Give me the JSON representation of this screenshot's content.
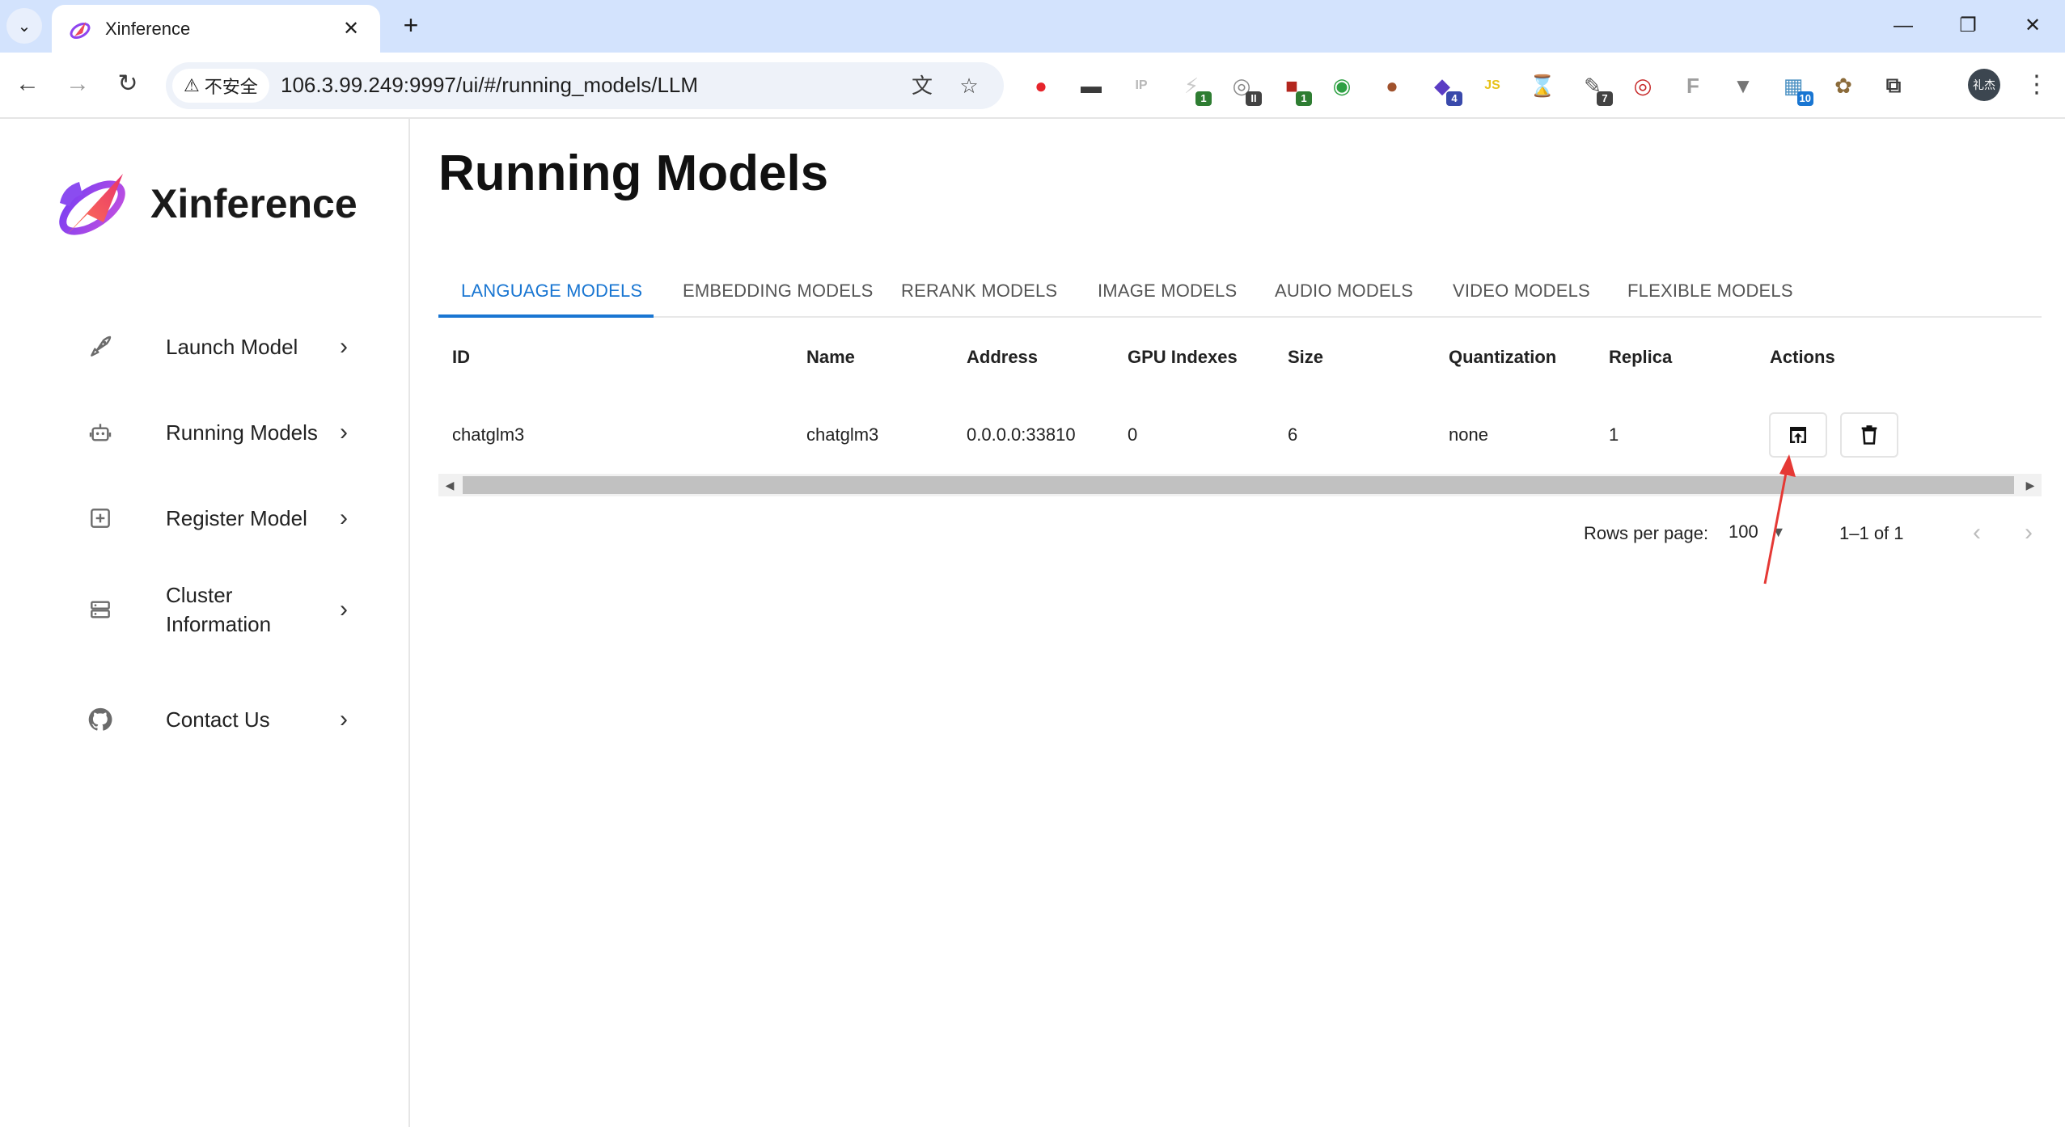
{
  "browser": {
    "tab_title": "Xinference",
    "security_label": "不安全",
    "url": "106.3.99.249:9997/ui/#/running_models/LLM",
    "extensions": [
      {
        "name": "opera-red-circle-icon",
        "color": "#e6252c",
        "badge": ""
      },
      {
        "name": "mask-extension-icon",
        "color": "#3a3a3a",
        "badge": ""
      },
      {
        "name": "ip-extension-icon",
        "color": "#b8b8b8",
        "badge": ""
      },
      {
        "name": "lightning-extension-icon",
        "color": "#c9c9c9",
        "badge": "1"
      },
      {
        "name": "globe-extension-icon",
        "color": "#8a8a8a",
        "badge": "II"
      },
      {
        "name": "red-square-extension-icon",
        "color": "#b3261e",
        "badge": "1"
      },
      {
        "name": "green-circle-extension-icon",
        "color": "#2ea043",
        "badge": ""
      },
      {
        "name": "cookie-extension-icon",
        "color": "#a0522d",
        "badge": ""
      },
      {
        "name": "purple-extension-icon",
        "color": "#5b3cc4",
        "badge": "4"
      },
      {
        "name": "js-extension-icon",
        "color": "#e8c21b",
        "badge": ""
      },
      {
        "name": "hourglass-extension-icon",
        "color": "#9cb8d6",
        "badge": ""
      },
      {
        "name": "script-extension-icon",
        "color": "#555555",
        "badge": "7"
      },
      {
        "name": "target-extension-icon",
        "color": "#c62828",
        "badge": ""
      },
      {
        "name": "f-extension-icon",
        "color": "#9e9e9e",
        "badge": ""
      },
      {
        "name": "v-extension-icon",
        "color": "#757575",
        "badge": ""
      },
      {
        "name": "calendar-extension-icon",
        "color": "#4a90c2",
        "badge": "10"
      },
      {
        "name": "tiger-extension-icon",
        "color": "#8b6b3a",
        "badge": ""
      },
      {
        "name": "puzzle-extensions-icon",
        "color": "#3c3c3c",
        "badge": ""
      }
    ],
    "profile_initials": "礼杰"
  },
  "app": {
    "brand": "Xinference",
    "nav": [
      {
        "label": "Launch Model",
        "icon": "rocket-icon"
      },
      {
        "label": "Running Models",
        "icon": "robot-icon"
      },
      {
        "label": "Register Model",
        "icon": "add-box-icon"
      },
      {
        "label": "Cluster Information",
        "icon": "server-icon"
      },
      {
        "label": "Contact Us",
        "icon": "github-icon"
      }
    ]
  },
  "main": {
    "title": "Running Models",
    "tabs": [
      "LANGUAGE MODELS",
      "EMBEDDING MODELS",
      "RERANK MODELS",
      "IMAGE MODELS",
      "AUDIO MODELS",
      "VIDEO MODELS",
      "FLEXIBLE MODELS"
    ],
    "active_tab": "LANGUAGE MODELS",
    "columns": [
      "ID",
      "Name",
      "Address",
      "GPU Indexes",
      "Size",
      "Quantization",
      "Replica",
      "Actions"
    ],
    "rows": [
      {
        "id": "chatglm3",
        "name": "chatglm3",
        "address": "0.0.0.0:33810",
        "gpu_indexes": "0",
        "size": "6",
        "quantization": "none",
        "replica": "1"
      }
    ],
    "pagination": {
      "rows_per_page_label": "Rows per page:",
      "rows_per_page": "100",
      "range": "1–1 of 1"
    }
  },
  "colors": {
    "accent": "#1976d2",
    "annotation_arrow": "#e53935",
    "tabbar": "#d3e3fd"
  }
}
